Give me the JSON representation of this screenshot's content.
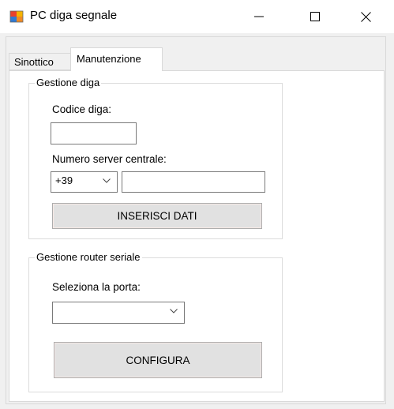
{
  "window": {
    "title": "PC diga segnale",
    "icon": "app-window-icon",
    "controls": [
      "minimize-icon",
      "maximize-icon",
      "close-icon"
    ]
  },
  "tabs": [
    {
      "label": "Sinottico",
      "selected": false
    },
    {
      "label": "Manutenzione",
      "selected": true
    }
  ],
  "gestione_diga": {
    "legend": "Gestione diga",
    "codice_label": "Codice diga:",
    "codice_value": "",
    "numero_label": "Numero server centrale:",
    "prefix_value": "+39",
    "numero_value": "",
    "inserisci_button": "INSERISCI DATI"
  },
  "gestione_router": {
    "legend": "Gestione router seriale",
    "porta_label": "Seleziona la porta:",
    "porta_value": "",
    "configura_button": "CONFIGURA"
  },
  "colors": {
    "titlebar": "#ffffff",
    "client_background": "#f0f0f0",
    "tab_page": "#ffffff",
    "button_face": "#e1e1e1",
    "border": "#d9d9d9"
  }
}
